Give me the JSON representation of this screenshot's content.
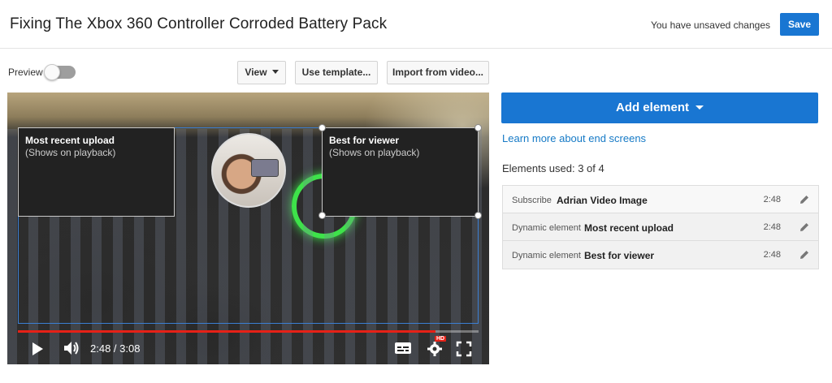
{
  "header": {
    "title": "Fixing The Xbox 360 Controller Corroded Battery Pack",
    "unsaved_text": "You have unsaved changes",
    "save_label": "Save"
  },
  "toolbar": {
    "preview_label": "Preview",
    "preview_on": false,
    "view_label": "View",
    "template_label": "Use template...",
    "import_label": "Import from video..."
  },
  "player": {
    "cards": [
      {
        "title": "Most recent upload",
        "subtitle": "(Shows on playback)"
      },
      {
        "title": "Best for viewer",
        "subtitle": "(Shows on playback)"
      }
    ],
    "time": "2:48 / 3:08",
    "progress": 0.906,
    "hd_badge": "HD"
  },
  "panel": {
    "add_label": "Add element",
    "learn_link": "Learn more about end screens",
    "elements_used": "Elements used: 3 of 4",
    "elements": [
      {
        "type": "Subscribe",
        "name": "Adrian Video Image",
        "time": "2:48"
      },
      {
        "type": "Dynamic element",
        "name": "Most recent upload",
        "time": "2:48"
      },
      {
        "type": "Dynamic element",
        "name": "Best for viewer",
        "time": "2:48"
      }
    ]
  },
  "colors": {
    "accent": "#1976d2",
    "progress": "#e62117",
    "link": "#167ac6"
  }
}
